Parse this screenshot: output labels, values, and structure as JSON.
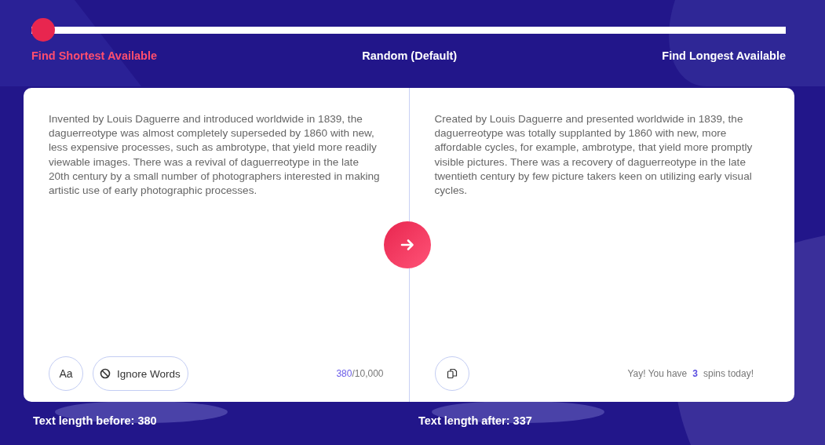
{
  "length_slider": {
    "level": 0,
    "options": [
      {
        "label": "Find Shortest Available",
        "selected": true
      },
      {
        "label": "Random (Default)",
        "selected": false
      },
      {
        "label": "Find Longest Available",
        "selected": false
      }
    ]
  },
  "input_panel": {
    "text": "Invented by Louis Daguerre and introduced worldwide in 1839, the daguerreotype was almost completely superseded by 1860 with new, less expensive processes, such as ambrotype, that yield more readily viewable images. There was a revival of daguerreotype in the late 20th century by a small number of photographers interested in making artistic use of early photographic processes.",
    "font_button": "Aa",
    "ignore_button": "Ignore Words",
    "count": "380",
    "limit": "/10,000"
  },
  "output_panel": {
    "text": "Created by Louis Daguerre and presented worldwide in 1839, the daguerreotype was totally supplanted by 1860 with new, more affordable cycles, for example, ambrotype, that yield more promptly visible pictures. There was a recovery of daguerreotype in the late twentieth century by few picture takers keen on utilizing early visual cycles.",
    "spins_prefix": "Yay! You have",
    "spins": "3",
    "spins_suffix": "spins today!"
  },
  "length_before": "Text length before: 380",
  "length_after": "Text length after: 337"
}
